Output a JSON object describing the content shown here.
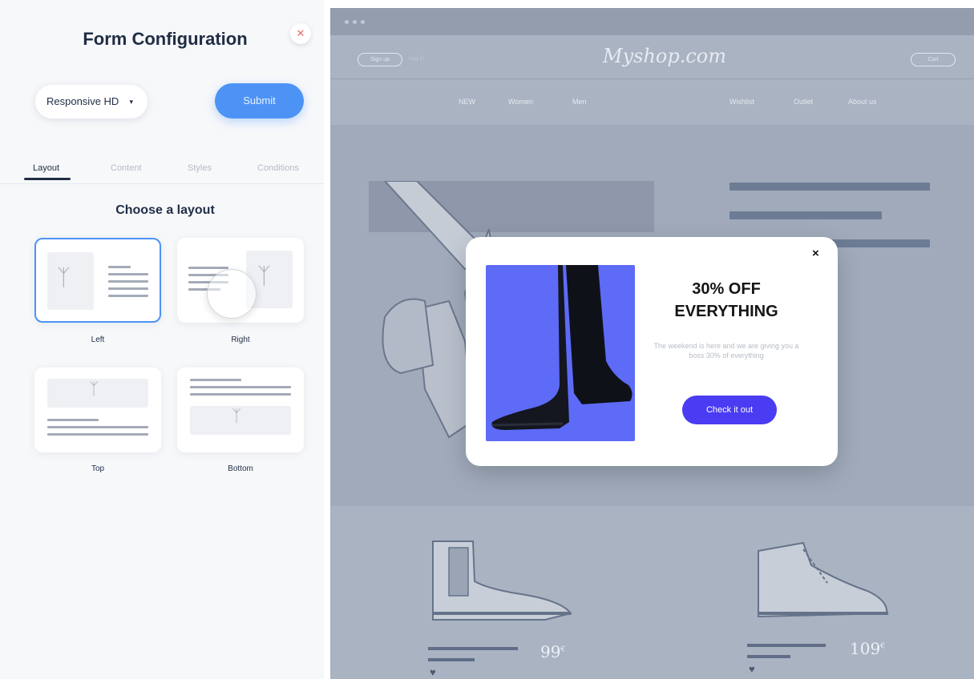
{
  "panel": {
    "title": "Form Configuration",
    "close_icon": "close-icon",
    "device_select": {
      "value": "Responsive HD",
      "caret": "▾"
    },
    "submit_label": "Submit",
    "tabs": [
      {
        "label": "Layout",
        "active": true
      },
      {
        "label": "Content",
        "active": false
      },
      {
        "label": "Styles",
        "active": false
      },
      {
        "label": "Conditions",
        "active": false
      }
    ],
    "section_title": "Choose a layout",
    "layouts": [
      {
        "label": "Left",
        "selected": true
      },
      {
        "label": "Right",
        "selected": false
      },
      {
        "label": "Top",
        "selected": false
      },
      {
        "label": "Bottom",
        "selected": false
      }
    ],
    "accent_color": "#4c93f5"
  },
  "site": {
    "signup": "Sign up",
    "login": "Log in",
    "logo": "Myshop.com",
    "cart": "Cart",
    "nav": [
      "NEW",
      "Women",
      "Men",
      "Wishlist",
      "Outlet",
      "About us"
    ],
    "products": [
      {
        "price": "99",
        "currency": "€"
      },
      {
        "price": "109",
        "currency": "€"
      }
    ]
  },
  "popup": {
    "headline_1": "30% OFF",
    "headline_2": "EVERYTHING",
    "body": "The weekend is here and we are giving you a boss 30% of everything",
    "cta": "Check it out",
    "close_glyph": "×",
    "image_bg": "#5d6bf7",
    "cta_color": "#4a3cf2"
  }
}
